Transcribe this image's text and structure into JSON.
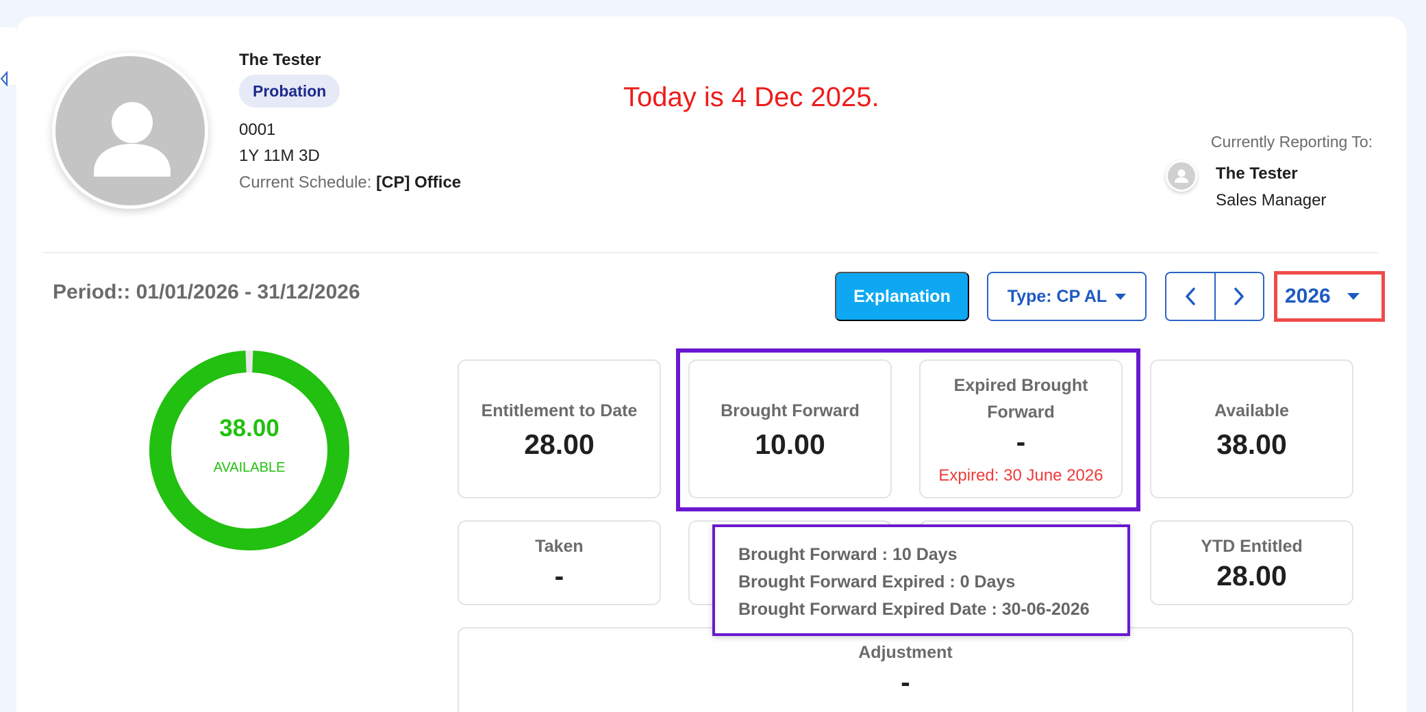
{
  "employee": {
    "name": "The Tester",
    "status_badge": "Probation",
    "id": "0001",
    "tenure": "1Y 11M 3D",
    "schedule_label": "Current Schedule:",
    "schedule_value": "[CP] Office"
  },
  "annotation": {
    "today_text": "Today is 4 Dec 2025."
  },
  "reporting": {
    "label": "Currently Reporting To:",
    "name": "The Tester",
    "role": "Sales Manager"
  },
  "period": {
    "text": "Period:: 01/01/2026 - 31/12/2026"
  },
  "toolbar": {
    "explanation_label": "Explanation",
    "type_label": "Type: CP AL",
    "year_label": "2026"
  },
  "donut": {
    "value_text": "38.00",
    "label": "AVAILABLE",
    "fraction": 1.0,
    "color": "#22c010"
  },
  "tiles": {
    "entitlement": {
      "label": "Entitlement to Date",
      "value": "28.00"
    },
    "brought_forward": {
      "label": "Brought Forward",
      "value": "10.00"
    },
    "expired_bf": {
      "label": "Expired Brought Forward",
      "value": "-",
      "expired_note": "Expired: 30 June 2026"
    },
    "available": {
      "label": "Available",
      "value": "38.00"
    },
    "taken": {
      "label": "Taken",
      "value": "-"
    },
    "ytd_entitled": {
      "label": "YTD Entitled",
      "value": "28.00"
    },
    "adjustment": {
      "label": "Adjustment",
      "value": "-"
    }
  },
  "tooltip": {
    "lines": [
      "Brought Forward : 10 Days",
      "Brought Forward Expired : 0 Days",
      "Brought Forward Expired Date : 30-06-2026"
    ]
  },
  "colors": {
    "accent": "#0ea8f2",
    "brand_blue": "#1e5ac2",
    "highlight_purple": "#6a18cf",
    "highlight_red": "#ef4a4a",
    "annotation_red": "#ee1c1c"
  }
}
